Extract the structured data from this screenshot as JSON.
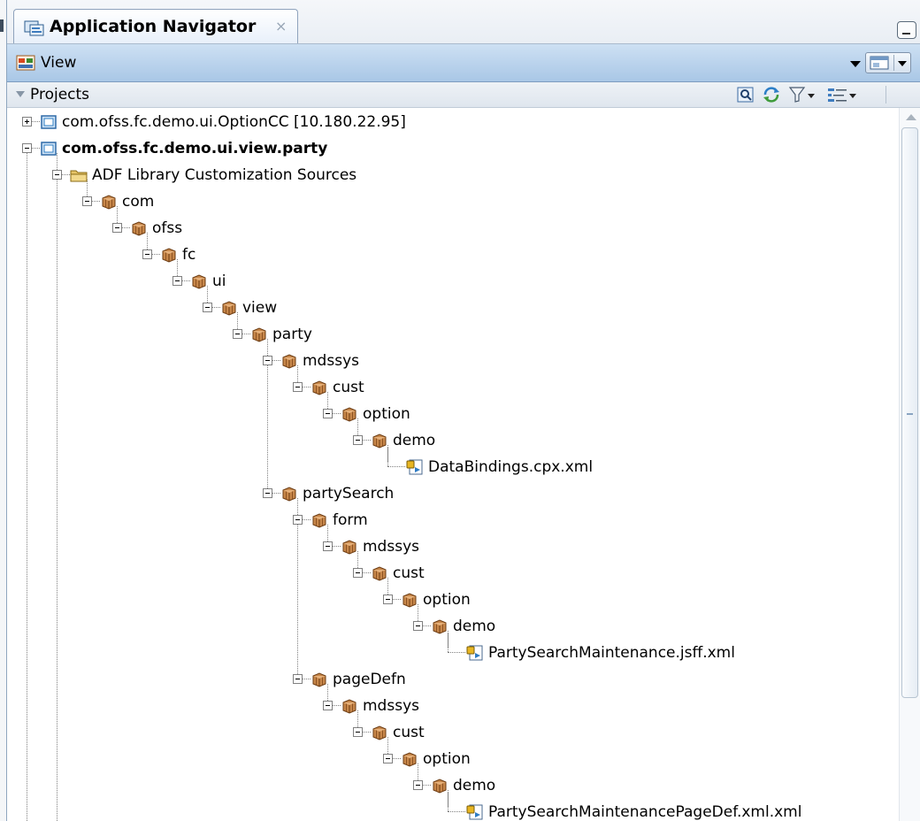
{
  "panel": {
    "tab_title": "Application Navigator",
    "tab_close": "×",
    "view_label": "View",
    "projects_label": "Projects",
    "toolbar_icons": [
      "search-icon",
      "sync-icon",
      "filter-icon",
      "sort-icon"
    ]
  },
  "colors": {
    "view_bar": "#b8d2ec",
    "package_icon": "#c7874a",
    "folder_icon": "#e6c466",
    "project_icon": "#2f7fc4"
  },
  "tree": [
    {
      "label": "com.ofss.fc.demo.ui.OptionCC [10.180.22.95]",
      "icon": "project-icon",
      "expanded": false,
      "bold": false,
      "level": 0
    },
    {
      "label": "com.ofss.fc.demo.ui.view.party",
      "icon": "project-icon",
      "expanded": true,
      "bold": true,
      "level": 0
    },
    {
      "label": "ADF Library Customization Sources",
      "icon": "folder-icon",
      "expanded": true,
      "bold": false,
      "level": 1
    },
    {
      "label": "com",
      "icon": "package-icon",
      "expanded": true,
      "bold": false,
      "level": 2
    },
    {
      "label": "ofss",
      "icon": "package-icon",
      "expanded": true,
      "bold": false,
      "level": 3
    },
    {
      "label": "fc",
      "icon": "package-icon",
      "expanded": true,
      "bold": false,
      "level": 4
    },
    {
      "label": "ui",
      "icon": "package-icon",
      "expanded": true,
      "bold": false,
      "level": 5
    },
    {
      "label": "view",
      "icon": "package-icon",
      "expanded": true,
      "bold": false,
      "level": 6
    },
    {
      "label": "party",
      "icon": "package-icon",
      "expanded": true,
      "bold": false,
      "level": 7
    },
    {
      "label": "mdssys",
      "icon": "package-icon",
      "expanded": true,
      "bold": false,
      "level": 8
    },
    {
      "label": "cust",
      "icon": "package-icon",
      "expanded": true,
      "bold": false,
      "level": 9
    },
    {
      "label": "option",
      "icon": "package-icon",
      "expanded": true,
      "bold": false,
      "level": 10
    },
    {
      "label": "demo",
      "icon": "package-icon",
      "expanded": true,
      "bold": false,
      "level": 11
    },
    {
      "label": "DataBindings.cpx.xml",
      "icon": "xml-file-icon",
      "expanded": null,
      "bold": false,
      "level": 12
    },
    {
      "label": "partySearch",
      "icon": "package-icon",
      "expanded": true,
      "bold": false,
      "level": 8
    },
    {
      "label": "form",
      "icon": "package-icon",
      "expanded": true,
      "bold": false,
      "level": 9
    },
    {
      "label": "mdssys",
      "icon": "package-icon",
      "expanded": true,
      "bold": false,
      "level": 10
    },
    {
      "label": "cust",
      "icon": "package-icon",
      "expanded": true,
      "bold": false,
      "level": 11
    },
    {
      "label": "option",
      "icon": "package-icon",
      "expanded": true,
      "bold": false,
      "level": 12
    },
    {
      "label": "demo",
      "icon": "package-icon",
      "expanded": true,
      "bold": false,
      "level": 13
    },
    {
      "label": "PartySearchMaintenance.jsff.xml",
      "icon": "xml-file-icon",
      "expanded": null,
      "bold": false,
      "level": 14
    },
    {
      "label": "pageDefn",
      "icon": "package-icon",
      "expanded": true,
      "bold": false,
      "level": 9
    },
    {
      "label": "mdssys",
      "icon": "package-icon",
      "expanded": true,
      "bold": false,
      "level": 10
    },
    {
      "label": "cust",
      "icon": "package-icon",
      "expanded": true,
      "bold": false,
      "level": 11
    },
    {
      "label": "option",
      "icon": "package-icon",
      "expanded": true,
      "bold": false,
      "level": 12
    },
    {
      "label": "demo",
      "icon": "package-icon",
      "expanded": true,
      "bold": false,
      "level": 13
    },
    {
      "label": "PartySearchMaintenancePageDef.xml.xml",
      "icon": "xml-file-icon",
      "expanded": null,
      "bold": false,
      "level": 14
    }
  ]
}
